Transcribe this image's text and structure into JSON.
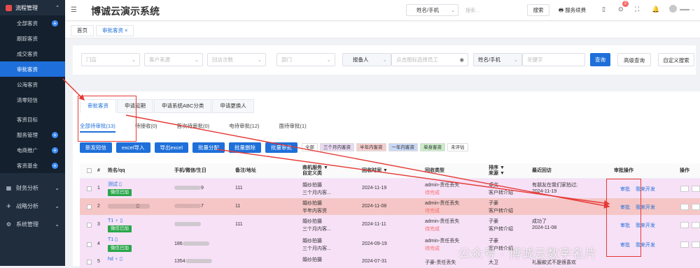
{
  "sidebar": {
    "head": "流程管理",
    "items": [
      "全部客资",
      "跟踪客资",
      "成交客资",
      "审批客资",
      "公海客资",
      "清零短信",
      "客资目标",
      "服务管理",
      "电商推广",
      "客资基金"
    ],
    "groups": [
      "财务分析",
      "战略分析",
      "系统管理"
    ]
  },
  "topbar": {
    "title": "博诚云演示系统",
    "select": "姓名/手机",
    "search_ph": "搜索...",
    "search_btn": "搜索",
    "renew": "服务续费",
    "badge": "2"
  },
  "pagetabs": {
    "home": "首页",
    "approve": "审批客资"
  },
  "filters": {
    "store": "门店",
    "source": "客户来源",
    "intention": "回访次数",
    "dept": "部门",
    "reporter": "报备人",
    "emp_ph": "点击图标选择员工",
    "field": "姓名/手机",
    "kw_ph": "关键字",
    "query": "查询",
    "advanced": "高级查询",
    "custom": "自定义搜索"
  },
  "tabs1": [
    "审批客资",
    "申请延期",
    "申请系统ABC分类",
    "申请更换人"
  ],
  "tabs2": [
    "全部待审批(13)",
    "待接收(0)",
    "首次待审批(0)",
    "电待审批(12)",
    "面待审批(1)"
  ],
  "actions": [
    "新发短信",
    "excel导入",
    "导出excel",
    "批量分配",
    "批量删除",
    "批量审批"
  ],
  "tags": [
    "全部",
    "三个月内客资",
    "半年内客资",
    "一年内客资",
    "单身客资",
    "未评估"
  ],
  "table_header": {
    "num": "#",
    "name": "姓名/qq",
    "phone": "手机/微信/生日",
    "note": "备注/地址",
    "biz": "商机服务 ▼",
    "biz2": "自定义类",
    "time": "回收时间 ▼",
    "type": "回收类型",
    "sort": "排序 ▼",
    "src": "来源 ▼",
    "last": "最近回访",
    "op": "审批操作",
    "op2": "操作"
  },
  "rows": [
    {
      "no": "1",
      "name": "测试",
      "tag": "微信已加",
      "phone": "9",
      "note": "111",
      "biz1": "婚纱拍摄",
      "biz2": "三个月内客...",
      "time": "2024-11-19",
      "type1": "admin-责任丢失",
      "type2": "待完成",
      "sort": "卓文",
      "src": "客户转介绍",
      "last1": "有朋友在我们家拍过;",
      "last2": "2024-11-19",
      "a1": "审批",
      "a2": "我来开发"
    },
    {
      "no": "2",
      "name": "",
      "tag": "",
      "phone": "7",
      "note": "11",
      "biz1": "婚纱拍摄",
      "biz2": "半年内客资",
      "time": "2024-11-08",
      "type1": "admin-责任丢失",
      "type2": "待完成",
      "sort": "子豪",
      "src": "客户转介绍",
      "last1": "",
      "last2": "",
      "a1": "审批",
      "a2": "我来开发"
    },
    {
      "no": "3",
      "name": "T1",
      "tag": "微信已加",
      "phone": "",
      "note": "111",
      "biz1": "婚纱拍摄",
      "biz2": "三个月内客...",
      "time": "2024-11-11",
      "type1": "admin-责任丢失",
      "type2": "待完成",
      "sort": "子豪",
      "src": "客户转介绍",
      "last1": "成功了",
      "last2": "2024-11-08",
      "a1": "审批",
      "a2": "我来开发"
    },
    {
      "no": "4",
      "name": "T1",
      "tag": "微信已加",
      "phone": "186",
      "note": "",
      "biz1": "婚纱拍摄",
      "biz2": "三个月内客...",
      "time": "2024-09-19",
      "type1": "admin-责任丢失",
      "type2": "待完成",
      "sort": "子豪",
      "src": "客户转介绍",
      "last1": "",
      "last2": "",
      "a1": "审批",
      "a2": "我来开发"
    },
    {
      "no": "5",
      "name": "hd",
      "tag": "",
      "phone": "1354",
      "note": "",
      "biz1": "婚纱拍摄",
      "biz2": "",
      "time": "2024-07-31",
      "type1": "子豪-责任丢失",
      "type2": "",
      "sort": "大卫",
      "src": "",
      "last1": "礼服款式不是很喜欢",
      "last2": "",
      "a1": "",
      "a2": ""
    }
  ],
  "watermark": "公众号 · 博诚云数字名片"
}
